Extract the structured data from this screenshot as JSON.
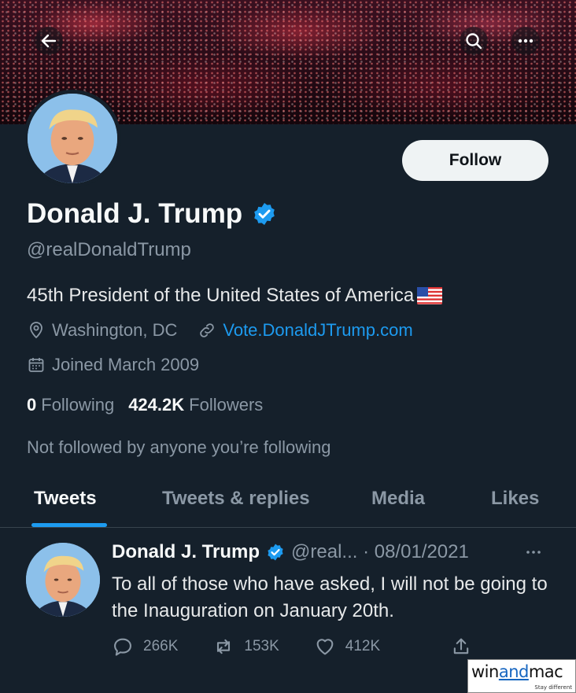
{
  "header": {
    "back_icon": "arrow-left-icon",
    "search_icon": "search-icon",
    "more_icon": "more-horizontal-icon"
  },
  "profile": {
    "follow_label": "Follow",
    "name": "Donald J. Trump",
    "handle": "@realDonaldTrump",
    "bio": "45th President of the United States of America",
    "location": "Washington, DC",
    "website": "Vote.DonaldJTrump.com",
    "joined": "Joined March 2009",
    "following_count": "0",
    "following_label": "Following",
    "followers_count": "424.2K",
    "followers_label": "Followers",
    "not_followed": "Not followed by anyone you’re following"
  },
  "tabs": [
    {
      "label": "Tweets",
      "active": true
    },
    {
      "label": "Tweets & replies",
      "active": false
    },
    {
      "label": "Media",
      "active": false
    },
    {
      "label": "Likes",
      "active": false
    }
  ],
  "tweet": {
    "name": "Donald J. Trump",
    "handle_date": "@real... · 08/01/2021",
    "text": "To all of those who have asked, I will not be going to the Inauguration on January 20th.",
    "replies": "266K",
    "retweets": "153K",
    "likes": "412K"
  },
  "watermark": {
    "win": "win",
    "and": "and",
    "mac": "mac",
    "tagline": "Stay different"
  },
  "colors": {
    "background": "#15202b",
    "accent": "#1d9bf0",
    "secondary_text": "#8b98a5"
  }
}
